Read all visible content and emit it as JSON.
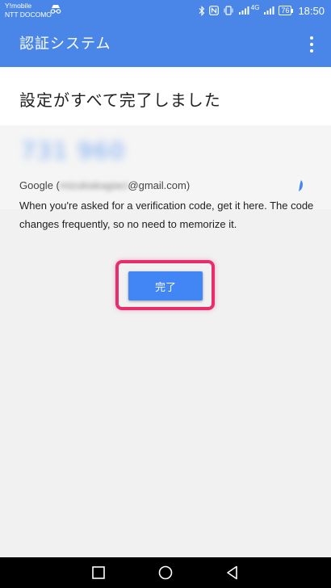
{
  "status_bar": {
    "carrier_line1": "Y!mobile",
    "carrier_line2": "NTT DOCOMO",
    "network_label": "4G",
    "battery": "76",
    "time": "18:50"
  },
  "app_bar": {
    "title": "認証システム",
    "menu_icon": "more-vert-icon"
  },
  "main": {
    "heading": "設定がすべて完了しました",
    "code": "731 960",
    "account_prefix": "Google (",
    "account_hidden": "mizukiakagiaci",
    "account_suffix": "@gmail.com)",
    "info": "When you're asked for a verification code, get it here. The code changes frequently, so no need to memorize it.",
    "done_label": "完了"
  },
  "colors": {
    "primary": "#4a86e8",
    "button": "#4285f4",
    "highlight": "#e72d6c"
  }
}
